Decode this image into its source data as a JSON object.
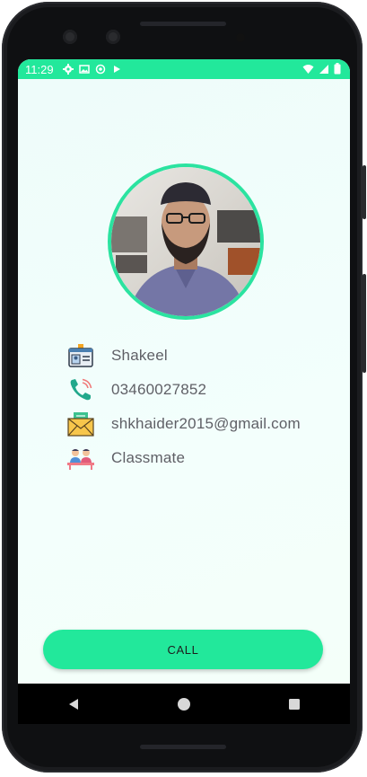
{
  "status_bar": {
    "time": "11:29",
    "icons": [
      "settings-icon",
      "image-icon",
      "sync-icon",
      "play-icon"
    ],
    "right_icons": [
      "wifi-icon",
      "signal-icon",
      "battery-icon"
    ]
  },
  "contact": {
    "name": "Shakeel",
    "phone": "03460027852",
    "email": "shkhaider2015@gmail.com",
    "relation": "Classmate"
  },
  "call_button": {
    "label": "CALL"
  },
  "nav": [
    "back-icon",
    "home-icon",
    "recents-icon"
  ],
  "colors": {
    "accent": "#22e89b",
    "ring": "#2be3a0",
    "text": "#5f5f66",
    "background": "#f1fdfb"
  }
}
